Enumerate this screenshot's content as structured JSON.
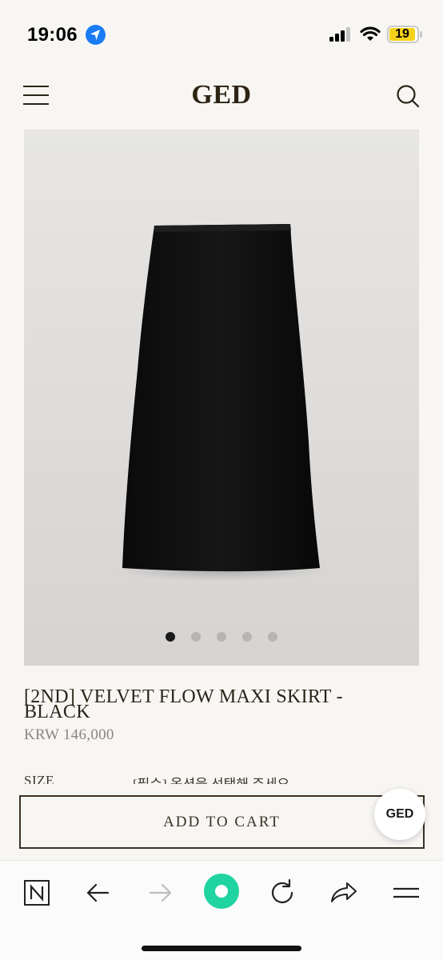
{
  "status_bar": {
    "time": "19:06",
    "battery": "19",
    "icons": [
      "location-arrow-icon",
      "cellular-signal-icon",
      "wifi-icon",
      "battery-icon"
    ]
  },
  "header": {
    "brand": "GED",
    "icons": [
      "hamburger-menu-icon",
      "search-icon"
    ]
  },
  "gallery": {
    "image": "black velvet maxi skirt product photo",
    "slide_count": 5,
    "active_slide": 1
  },
  "product": {
    "title_line1": "[2ND] VELVET FLOW MAXI SKIRT -",
    "title_line2": "BLACK",
    "price": "KRW 146,000"
  },
  "options": {
    "size_label": "SIZE",
    "size_value": "[필수] 옵션을 선택해 주세요"
  },
  "cta": {
    "add_to_cart": "ADD TO CART",
    "chat_badge": "GED"
  },
  "browser_toolbar": {
    "buttons": [
      "naver-n-icon",
      "back-arrow-icon",
      "forward-arrow-icon",
      "green-dot-icon",
      "reload-icon",
      "share-icon",
      "menu-icon"
    ]
  },
  "colors": {
    "background": "#f8f6f3",
    "text": "#2a2418",
    "price": "#8a8680",
    "accent_green": "#1fd4a0"
  }
}
